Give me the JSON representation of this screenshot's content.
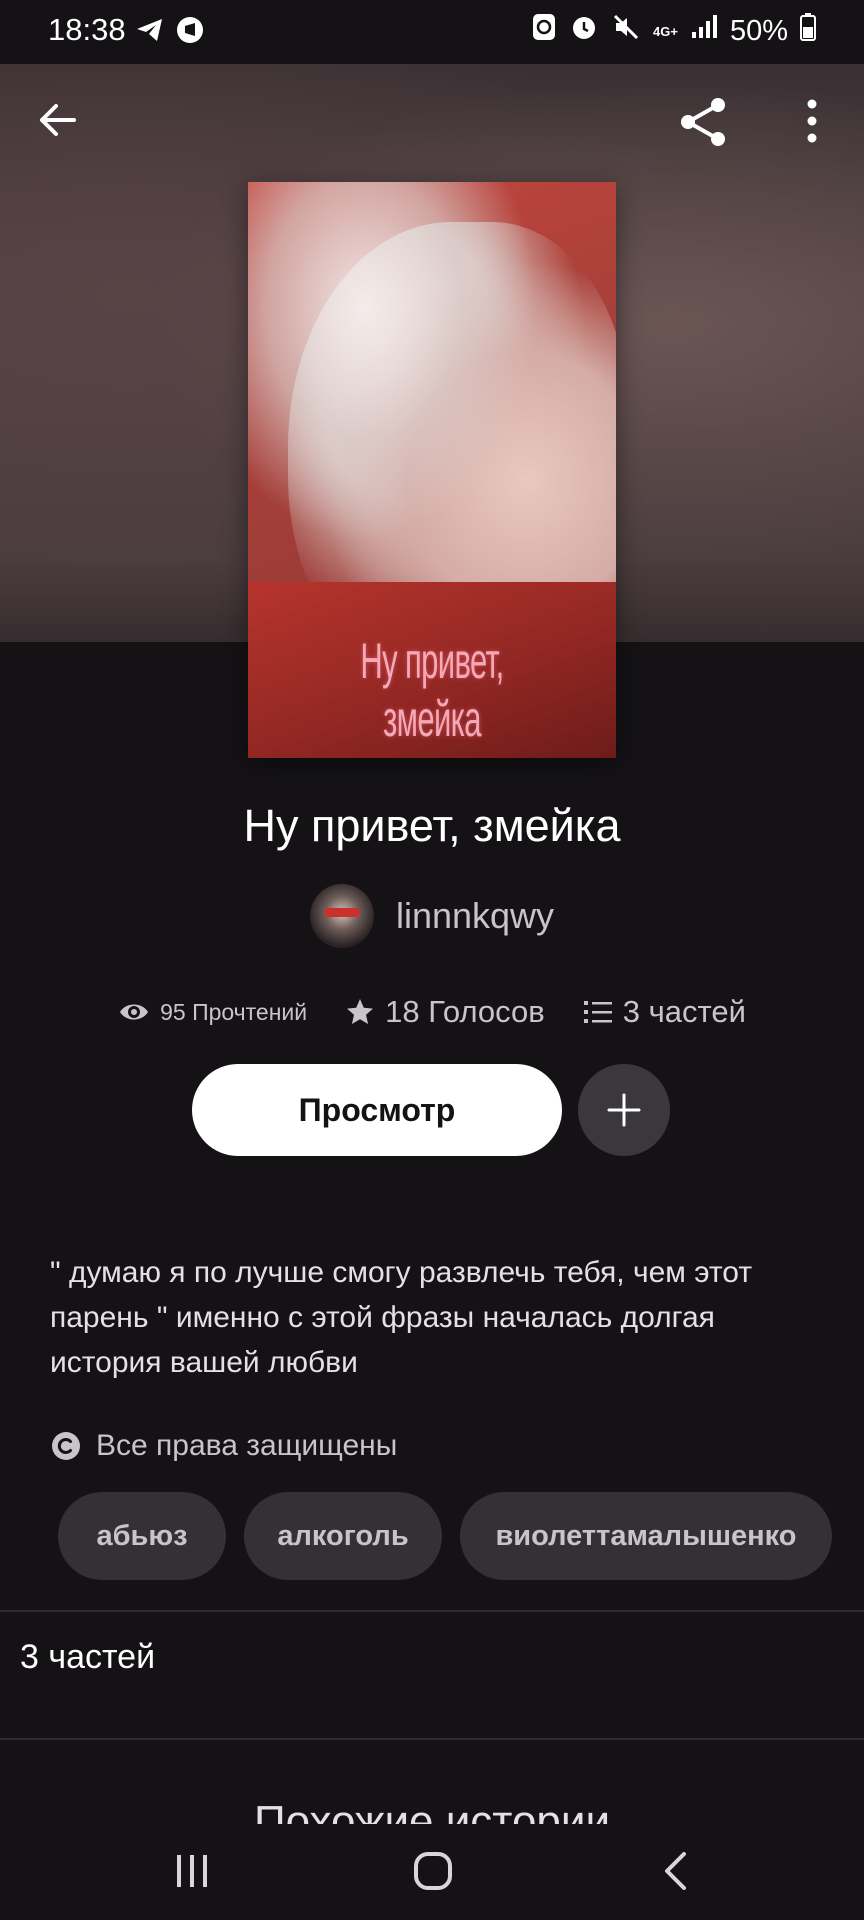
{
  "status_bar": {
    "time": "18:38",
    "network": "4G+",
    "battery": "50%"
  },
  "header": {
    "back_icon": "arrow-left-icon",
    "share_icon": "share-icon",
    "more_icon": "more-vertical-icon"
  },
  "story": {
    "cover_title": "Ну привет, змейка",
    "title": "Ну привет, змейка",
    "author": "linnnkqwy",
    "stats": {
      "reads": "95 Прочтений",
      "votes": "18 Голосов",
      "parts": "3 частей"
    },
    "read_button": "Просмотр",
    "description": "\" думаю я по лучше смогу развлечь тебя, чем этот парень \" именно с этой фразы началась долгая история вашей любви",
    "rights": "Все права защищены",
    "tags": [
      "абьюз",
      "алкоголь",
      "виолеттамалышенко"
    ]
  },
  "parts_section": {
    "label": "3 частей"
  },
  "similar_section": {
    "label": "Похожие истории"
  },
  "colors": {
    "background": "#141215",
    "tag_background": "#333136",
    "button_light": "#ffffff",
    "text_muted": "#c8c5c9",
    "cover_red": "#b7342d",
    "cover_title_pink": "#f5a9b7"
  }
}
